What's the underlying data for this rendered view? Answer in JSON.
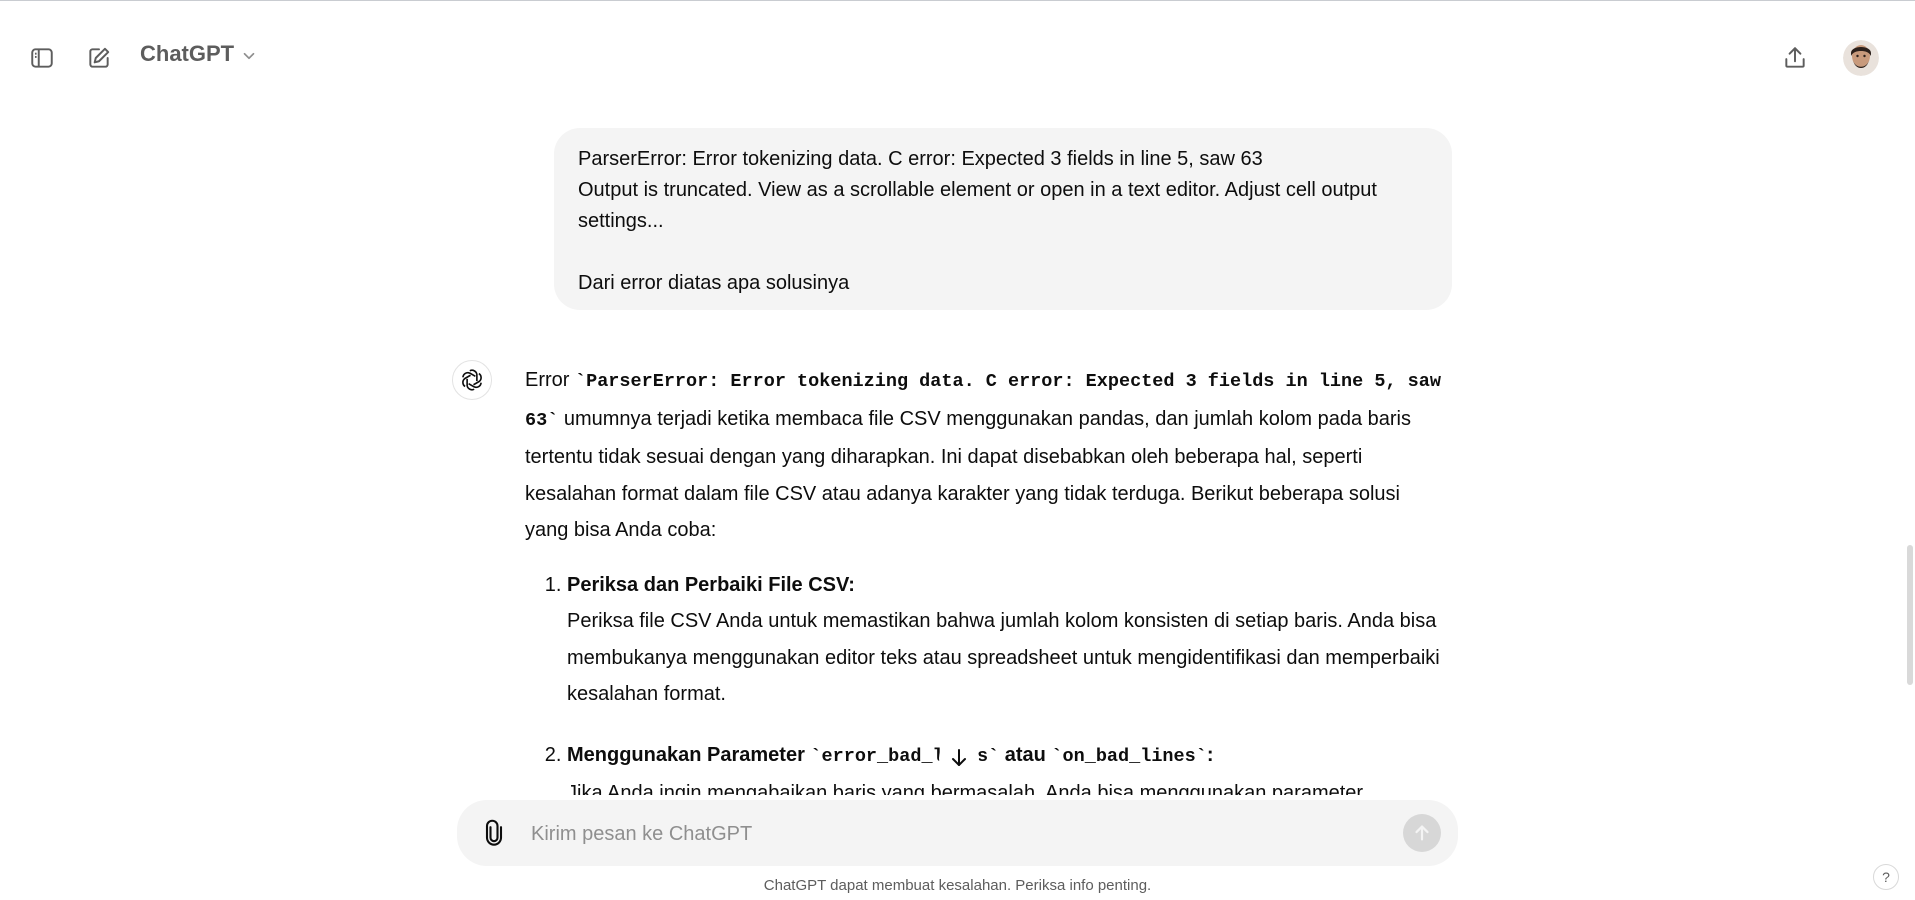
{
  "header": {
    "model_name": "ChatGPT",
    "icons": {
      "sidebar_toggle": "sidebar-toggle-icon",
      "new_chat": "new-chat-icon",
      "share": "share-icon",
      "model_dropdown": "chevron-down-icon"
    }
  },
  "user_message": {
    "lines": [
      "ParserError: Error tokenizing data. C error: Expected 3 fields in line 5, saw 63",
      "Output is truncated. View as a scrollable element or open in a text editor. Adjust cell output settings...",
      "",
      "Dari error diatas apa solusinya"
    ]
  },
  "assistant_message": {
    "intro_prefix": "Error ",
    "intro_code": "`ParserError: Error tokenizing data. C error: Expected 3 fields in line 5, saw 63`",
    "intro_rest": " umumnya terjadi ketika membaca file CSV menggunakan pandas, dan jumlah kolom pada baris tertentu tidak sesuai dengan yang diharapkan. Ini dapat disebabkan oleh beberapa hal, seperti kesalahan format dalam file CSV atau adanya karakter yang tidak terduga. Berikut beberapa solusi yang bisa Anda coba:",
    "steps": [
      {
        "title": "Periksa dan Perbaiki File CSV:",
        "body": "Periksa file CSV Anda untuk memastikan bahwa jumlah kolom konsisten di setiap baris. Anda bisa membukanya menggunakan editor teks atau spreadsheet untuk mengidentifikasi dan memperbaiki kesalahan format."
      },
      {
        "title_prefix": "Menggunakan Parameter ",
        "title_code1": "`error_bad_lines`",
        "title_mid": " atau ",
        "title_code2": "`on_bad_lines`",
        "title_suffix": ":",
        "body": "Jika Anda ingin mengabaikan baris yang bermasalah, Anda bisa menggunakan parameter"
      }
    ]
  },
  "composer": {
    "placeholder": "Kirim pesan ke ChatGPT",
    "value": ""
  },
  "footer": {
    "disclaimer": "ChatGPT dapat membuat kesalahan. Periksa info penting.",
    "help_label": "?"
  }
}
